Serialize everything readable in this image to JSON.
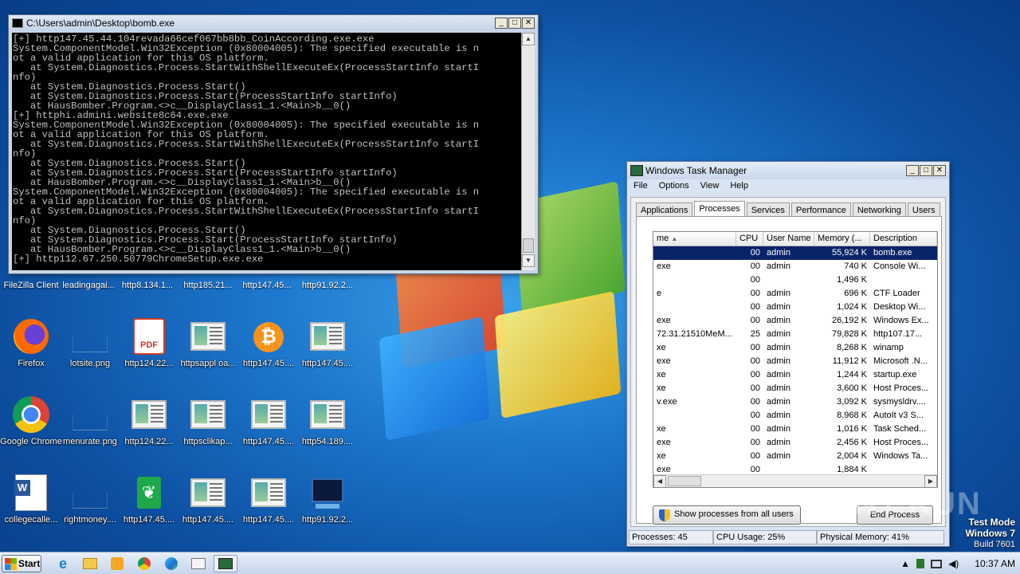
{
  "console": {
    "title": "C:\\Users\\admin\\Desktop\\bomb.exe",
    "lines": [
      "[+] http147.45.44.104revada66cef067bb8bb_CoinAccording.exe.exe",
      "System.ComponentModel.Win32Exception (0x80004005): The specified executable is n",
      "ot a valid application for this OS platform.",
      "   at System.Diagnostics.Process.StartWithShellExecuteEx(ProcessStartInfo startI",
      "nfo)",
      "   at System.Diagnostics.Process.Start()",
      "   at System.Diagnostics.Process.Start(ProcessStartInfo startInfo)",
      "   at HausBomber.Program.<>c__DisplayClass1_1.<Main>b__0()",
      "[+] httphi.admini.website8c64.exe.exe",
      "System.ComponentModel.Win32Exception (0x80004005): The specified executable is n",
      "ot a valid application for this OS platform.",
      "   at System.Diagnostics.Process.StartWithShellExecuteEx(ProcessStartInfo startI",
      "nfo)",
      "   at System.Diagnostics.Process.Start()",
      "   at System.Diagnostics.Process.Start(ProcessStartInfo startInfo)",
      "   at HausBomber.Program.<>c__DisplayClass1_1.<Main>b__0()",
      "System.ComponentModel.Win32Exception (0x80004005): The specified executable is n",
      "ot a valid application for this OS platform.",
      "   at System.Diagnostics.Process.StartWithShellExecuteEx(ProcessStartInfo startI",
      "nfo)",
      "   at System.Diagnostics.Process.Start()",
      "   at System.Diagnostics.Process.Start(ProcessStartInfo startInfo)",
      "   at HausBomber.Program.<>c__DisplayClass1_1.<Main>b__0()",
      "[+] http112.67.250.50779ChromeSetup.exe.exe"
    ]
  },
  "desktop_labels_row0": [
    "FileZilla Client",
    "leadingagai...",
    "http8.134.1...",
    "http185.21...",
    "http147.45...",
    "http91.92.2..."
  ],
  "desktop_icons": [
    {
      "label": "Firefox",
      "icon": "firefox-icon"
    },
    {
      "label": "lotsite.png",
      "icon": "blank-file-icon"
    },
    {
      "label": "http124.22...",
      "icon": "pdf-icon"
    },
    {
      "label": "httpsappl oa...",
      "icon": "window-thumb-icon"
    },
    {
      "label": "http147.45....",
      "icon": "bitcoin-icon"
    },
    {
      "label": "http147.45....",
      "icon": "window-thumb-icon"
    },
    {
      "label": "Google Chrome",
      "icon": "chrome-icon"
    },
    {
      "label": "menurate.png",
      "icon": "blank-file-icon"
    },
    {
      "label": "http124.22...",
      "icon": "window-thumb-icon"
    },
    {
      "label": "httpsclikap...",
      "icon": "window-thumb-icon"
    },
    {
      "label": "http147.45....",
      "icon": "window-thumb-icon"
    },
    {
      "label": "http54.189....",
      "icon": "window-thumb-icon"
    },
    {
      "label": "collegecalle...",
      "icon": "word-icon"
    },
    {
      "label": "rightmoney....",
      "icon": "blank-file-icon"
    },
    {
      "label": "http147.45....",
      "icon": "leaf-icon"
    },
    {
      "label": "http147.45....",
      "icon": "window-thumb-icon"
    },
    {
      "label": "http147.45....",
      "icon": "window-thumb-icon"
    },
    {
      "label": "http91.92.2...",
      "icon": "terminal-icon"
    }
  ],
  "taskmgr": {
    "title": "Windows Task Manager",
    "menu": [
      "File",
      "Options",
      "View",
      "Help"
    ],
    "tabs": [
      "Applications",
      "Processes",
      "Services",
      "Performance",
      "Networking",
      "Users"
    ],
    "columns": [
      "me",
      "CPU",
      "User Name",
      "Memory (...",
      "Description"
    ],
    "rows": [
      [
        "",
        "00",
        "admin",
        "55,924 K",
        "bomb.exe"
      ],
      [
        "exe",
        "00",
        "admin",
        "740 K",
        "Console Wi..."
      ],
      [
        "",
        "00",
        "",
        "1,496 K",
        ""
      ],
      [
        "e",
        "00",
        "admin",
        "696 K",
        "CTF Loader"
      ],
      [
        "",
        "00",
        "admin",
        "1,024 K",
        "Desktop Wi..."
      ],
      [
        "exe",
        "00",
        "admin",
        "26,192 K",
        "Windows Ex..."
      ],
      [
        "72.31.21510MeM...",
        "25",
        "admin",
        "79,828 K",
        "http107.17..."
      ],
      [
        "xe",
        "00",
        "admin",
        "8,268 K",
        "winamp"
      ],
      [
        "exe",
        "00",
        "admin",
        "11,912 K",
        "Microsoft .N..."
      ],
      [
        "xe",
        "00",
        "admin",
        "1,244 K",
        "startup.exe"
      ],
      [
        "xe",
        "00",
        "admin",
        "3,600 K",
        "Host Proces..."
      ],
      [
        "v.exe",
        "00",
        "admin",
        "3,092 K",
        "sysmysldrv...."
      ],
      [
        "",
        "00",
        "admin",
        "8,968 K",
        "AutoIt v3 S..."
      ],
      [
        "xe",
        "00",
        "admin",
        "1,016 K",
        "Task Sched..."
      ],
      [
        "exe",
        "00",
        "admin",
        "2,456 K",
        "Host Proces..."
      ],
      [
        "xe",
        "00",
        "admin",
        "2,004 K",
        "Windows Ta..."
      ],
      [
        "exe",
        "00",
        "",
        "1,884 K",
        ""
      ]
    ],
    "show_all_label": "Show processes from all users",
    "end_process_label": "End Process",
    "status_processes": "Processes: 45",
    "status_cpu": "CPU Usage: 25%",
    "status_memory": "Physical Memory: 41%"
  },
  "watermark": "ANY.RUN",
  "testmode": {
    "line1": "Test Mode",
    "line2": "Windows 7",
    "line3": "Build 7601"
  },
  "taskbar": {
    "start_label": "Start",
    "clock": "10:37 AM"
  }
}
